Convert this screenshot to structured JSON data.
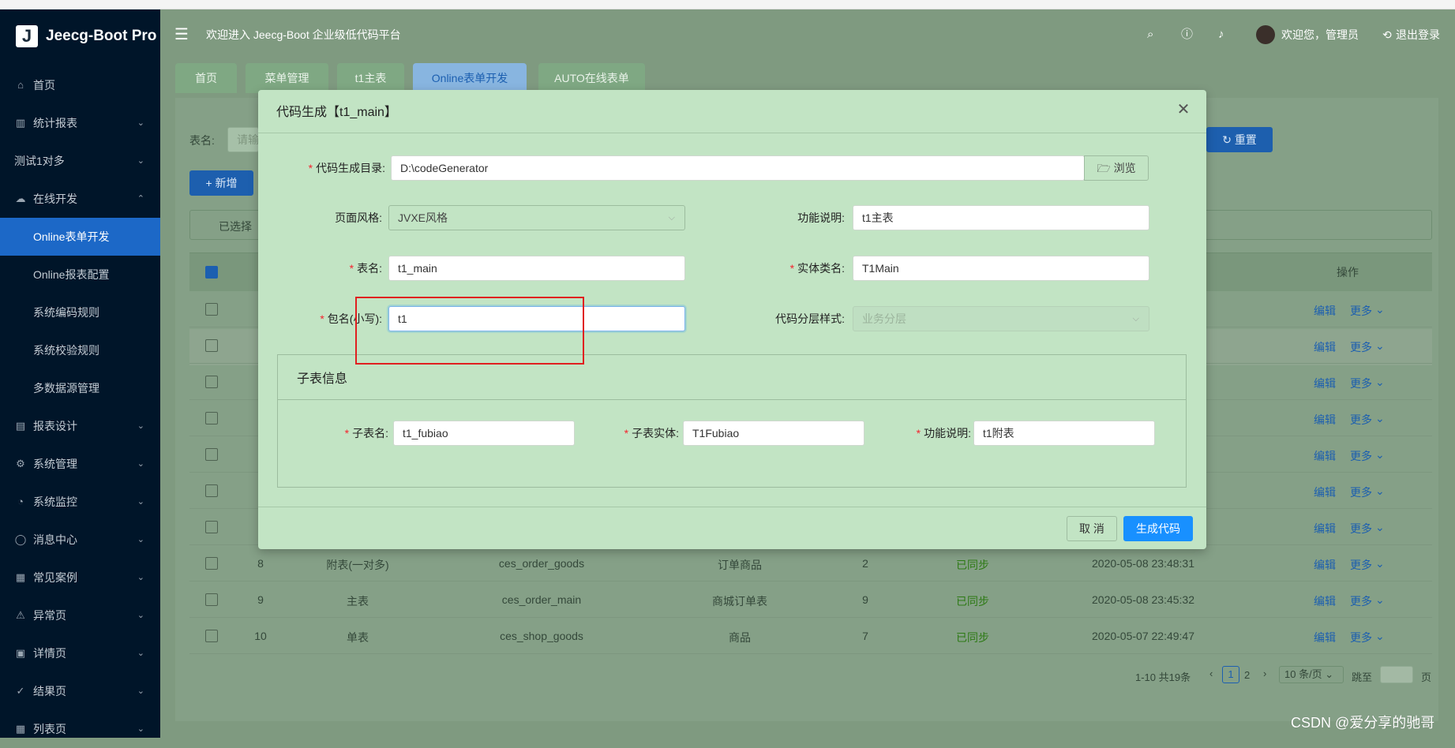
{
  "app": {
    "logo_char": "J",
    "name": "Jeecg-Boot Pro"
  },
  "header": {
    "welcome": "欢迎进入 Jeecg-Boot 企业级低代码平台",
    "greeting": "欢迎您，管理员",
    "logout": "退出登录"
  },
  "sidebar": {
    "items": [
      {
        "label": "首页",
        "icon": "home-icon",
        "glyph": "⌂"
      },
      {
        "label": "统计报表",
        "icon": "bar-chart-icon",
        "glyph": "▥"
      },
      {
        "label": "测试1对多",
        "icon": "",
        "glyph": ""
      },
      {
        "label": "在线开发",
        "icon": "cloud-icon",
        "glyph": "☁"
      },
      {
        "label": "Online表单开发",
        "icon": "",
        "glyph": ""
      },
      {
        "label": "Online报表配置",
        "icon": "",
        "glyph": ""
      },
      {
        "label": "系统编码规则",
        "icon": "",
        "glyph": ""
      },
      {
        "label": "系统校验规则",
        "icon": "",
        "glyph": ""
      },
      {
        "label": "多数据源管理",
        "icon": "",
        "glyph": ""
      },
      {
        "label": "报表设计",
        "icon": "area-chart-icon",
        "glyph": "▤"
      },
      {
        "label": "系统管理",
        "icon": "setting-icon",
        "glyph": "⚙"
      },
      {
        "label": "系统监控",
        "icon": "dashboard-icon",
        "glyph": "◔"
      },
      {
        "label": "消息中心",
        "icon": "message-icon",
        "glyph": "◯"
      },
      {
        "label": "常见案例",
        "icon": "appstore-icon",
        "glyph": "▦"
      },
      {
        "label": "异常页",
        "icon": "warning-icon",
        "glyph": "⚠"
      },
      {
        "label": "详情页",
        "icon": "profile-icon",
        "glyph": "▣"
      },
      {
        "label": "结果页",
        "icon": "check-circle-icon",
        "glyph": "✓"
      },
      {
        "label": "列表页",
        "icon": "table-icon",
        "glyph": "▦"
      }
    ]
  },
  "tabs": [
    "首页",
    "菜单管理",
    "t1主表",
    "Online表单开发",
    "AUTO在线表单"
  ],
  "filter": {
    "table_name_label": "表名:",
    "table_name_placeholder": "请输",
    "reset": "重置",
    "add": "新增",
    "selected": "已选择"
  },
  "table": {
    "header_action": "操作",
    "edit": "编辑",
    "more": "更多",
    "rows": [
      {
        "no": "8",
        "type": "附表(一对多)",
        "name": "ces_order_goods",
        "desc": "订单商品",
        "version": "2",
        "status": "已同步",
        "time": "2020-05-08 23:48:31"
      },
      {
        "no": "9",
        "type": "主表",
        "name": "ces_order_main",
        "desc": "商城订单表",
        "version": "9",
        "status": "已同步",
        "time": "2020-05-08 23:45:32"
      },
      {
        "no": "10",
        "type": "单表",
        "name": "ces_shop_goods",
        "desc": "商品",
        "version": "7",
        "status": "已同步",
        "time": "2020-05-07 22:49:47"
      }
    ]
  },
  "pagination": {
    "total": "1-10 共19条",
    "page1": "1",
    "page2": "2",
    "page_size": "10 条/页",
    "jump_to": "跳至",
    "page_unit": "页"
  },
  "modal": {
    "title": "代码生成【t1_main】",
    "fields": {
      "output_dir_label": "代码生成目录:",
      "output_dir_value": "D:\\codeGenerator",
      "browse": "浏览",
      "page_style_label": "页面风格:",
      "page_style_value": "JVXE风格",
      "func_desc_label": "功能说明:",
      "func_desc_value": "t1主表",
      "table_name_label": "表名:",
      "table_name_value": "t1_main",
      "entity_label": "实体类名:",
      "entity_value": "T1Main",
      "package_label": "包名(小写):",
      "package_value": "t1",
      "layer_label": "代码分层样式:",
      "layer_value": "业务分层"
    },
    "sub_table": {
      "title": "子表信息",
      "name_label": "子表名:",
      "name_value": "t1_fubiao",
      "entity_label": "子表实体:",
      "entity_value": "T1Fubiao",
      "desc_label": "功能说明:",
      "desc_value": "t1附表"
    },
    "cancel": "取 消",
    "generate": "生成代码"
  },
  "watermark": "CSDN @爱分享的驰哥",
  "colors": {
    "sidebar_bg": "#001529",
    "active_blue": "#1c68c7",
    "primary": "#1890ff",
    "modal_bg": "#c2e4c4",
    "highlight_red": "#e02020"
  }
}
